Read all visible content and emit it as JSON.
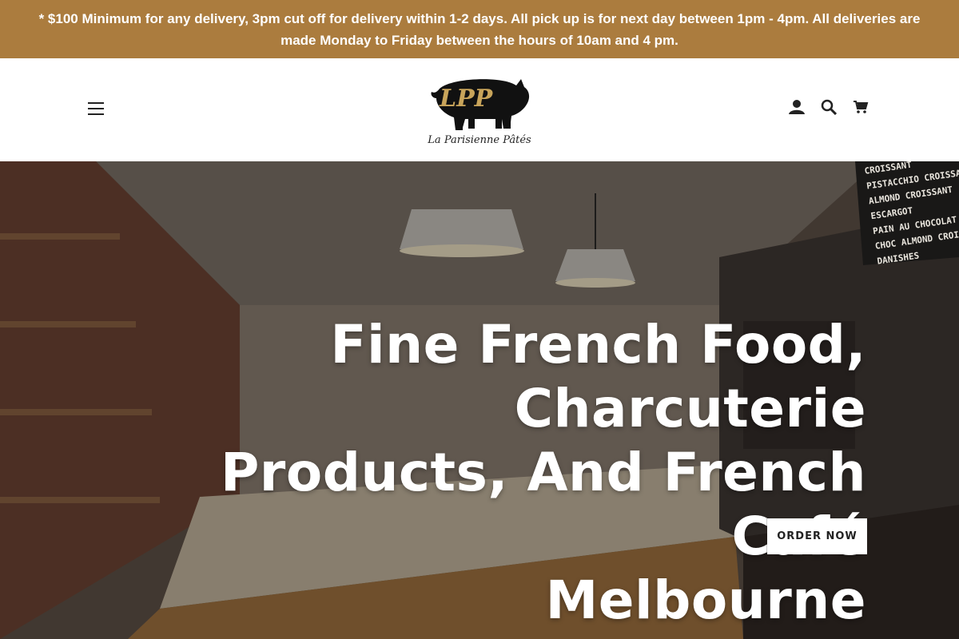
{
  "announcement": {
    "text": "* $100 Minimum for any delivery, 3pm cut off for delivery within 1-2 days. All pick up is for next day between 1pm - 4pm. All deliveries are made Monday to Friday between the hours of 10am and 4 pm."
  },
  "header": {
    "menu_icon": "hamburger-menu-icon",
    "logo": {
      "monogram": "LPP",
      "name": "La Parisienne Pâtés"
    },
    "icons": [
      "account-icon",
      "search-icon",
      "cart-icon"
    ]
  },
  "hero": {
    "title_lines": [
      "Fine French Food, Charcuterie",
      "Products, And French Café",
      "Melbourne"
    ],
    "cta_label": "ORDER NOW",
    "chalkboard": [
      "CROISSANT",
      "PISTACCHIO CROISSANT",
      "ALMOND CROISSANT",
      "ESCARGOT",
      "PAIN AU CHOCOLAT",
      "CHOC ALMOND CROISSANT",
      "DANISHES"
    ]
  },
  "colors": {
    "announcement_bg": "#ab7c3e",
    "logo_gold": "#c8a45a"
  }
}
